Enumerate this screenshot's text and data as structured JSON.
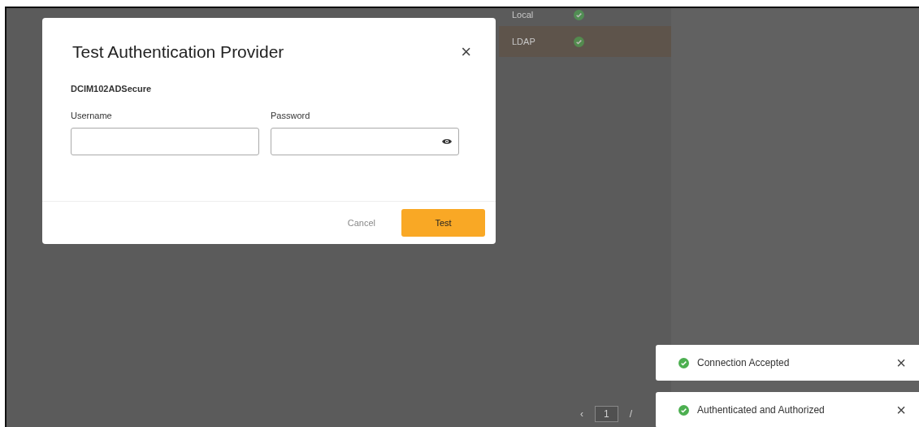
{
  "table": {
    "rows": [
      {
        "name": "Local",
        "selected": false
      },
      {
        "name": "LDAP",
        "selected": true
      }
    ]
  },
  "pagination": {
    "prev": "‹",
    "page": "1",
    "separator": "/"
  },
  "dialog": {
    "title": "Test Authentication Provider",
    "close": "×",
    "provider": "DCIM102ADSecure",
    "fields": [
      {
        "label": "Username",
        "kind": "text"
      },
      {
        "label": "Password",
        "kind": "password"
      }
    ],
    "buttons": [
      {
        "label": "Cancel",
        "kind": "flat"
      },
      {
        "label": "Test",
        "kind": "primary"
      }
    ]
  },
  "toasts": [
    {
      "message": "Connection Accepted",
      "close": "×"
    },
    {
      "message": "Authenticated and Authorized",
      "close": "×"
    }
  ]
}
